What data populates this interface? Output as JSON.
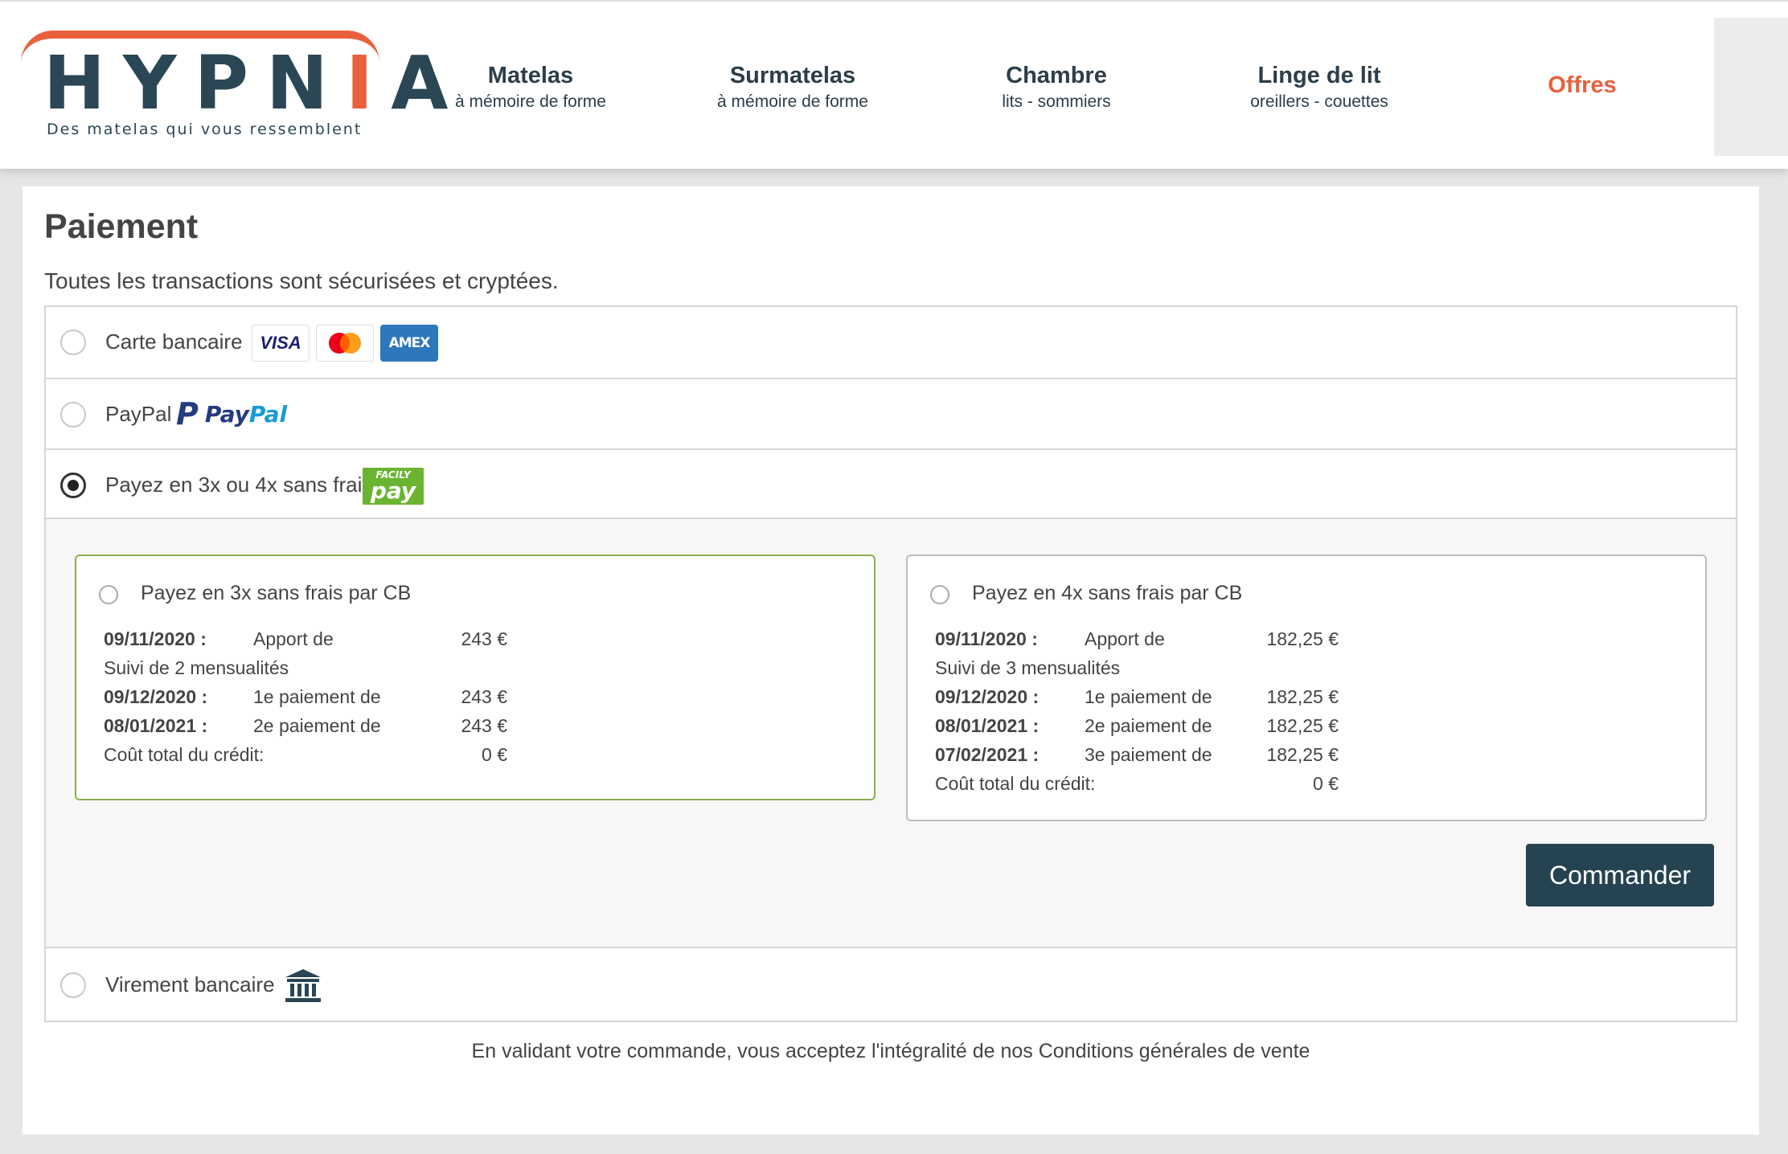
{
  "header": {
    "logo_text": "HYPNIA",
    "logo_tagline": "Des matelas qui vous ressemblent",
    "nav": [
      {
        "title": "Matelas",
        "subtitle": "à mémoire de forme"
      },
      {
        "title": "Surmatelas",
        "subtitle": "à mémoire de forme"
      },
      {
        "title": "Chambre",
        "subtitle": "lits - sommiers"
      },
      {
        "title": "Linge de lit",
        "subtitle": "oreillers - couettes"
      }
    ],
    "offers_label": "Offres"
  },
  "page": {
    "title": "Paiement",
    "subtitle": "Toutes les transactions sont sécurisées et cryptées."
  },
  "methods": {
    "card": {
      "label": "Carte bancaire",
      "logos": {
        "visa": "VISA",
        "amex": "AMEX"
      }
    },
    "paypal": {
      "label": "PayPal",
      "logo_pay": "Pay",
      "logo_pal": "Pal"
    },
    "installments": {
      "label": "Payez en 3x ou 4x sans frais",
      "logo_top": "FACILY",
      "logo_main": "pay",
      "selected": true
    },
    "transfer": {
      "label": "Virement bancaire"
    }
  },
  "plans": {
    "three": {
      "title": "Payez en 3x sans frais par CB",
      "first": {
        "date": "09/11/2020 :",
        "desc": "Apport de",
        "amount": "243 €"
      },
      "follow": "Suivi de 2 mensualités",
      "payments": [
        {
          "date": "09/12/2020 :",
          "desc": "1e paiement de",
          "amount": "243 €"
        },
        {
          "date": "08/01/2021 :",
          "desc": "2e paiement de",
          "amount": "243 €"
        }
      ],
      "total_label": "Coût total du crédit:",
      "total_amount": "0 €"
    },
    "four": {
      "title": "Payez en 4x sans frais par CB",
      "first": {
        "date": "09/11/2020 :",
        "desc": "Apport de",
        "amount": "182,25 €"
      },
      "follow": "Suivi de 3 mensualités",
      "payments": [
        {
          "date": "09/12/2020 :",
          "desc": "1e paiement de",
          "amount": "182,25 €"
        },
        {
          "date": "08/01/2021 :",
          "desc": "2e paiement de",
          "amount": "182,25 €"
        },
        {
          "date": "07/02/2021 :",
          "desc": "3e paiement de",
          "amount": "182,25 €"
        }
      ],
      "total_label": "Coût total du crédit:",
      "total_amount": "0 €"
    }
  },
  "submit_label": "Commander",
  "footer_note": "En validant votre commande, vous acceptez l'intégralité de nos Conditions générales de vente",
  "colors": {
    "brand_dark": "#2b4654",
    "accent": "#e8603c",
    "button": "#264351",
    "selected_border": "#8ab04a"
  }
}
